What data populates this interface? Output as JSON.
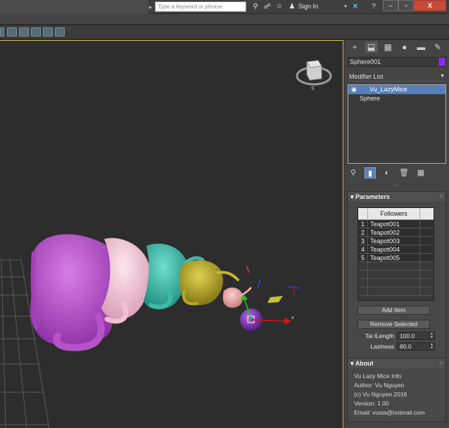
{
  "titlebar": {
    "search_placeholder": "Type a keyword or phrase",
    "signin_label": "Sign In",
    "help_label": "?",
    "window_close": "X"
  },
  "command_panel": {
    "tabs": [
      "create-icon",
      "modify-icon",
      "hierarchy-icon",
      "motion-icon",
      "display-icon",
      "utilities-icon"
    ],
    "object_name": "Sphere001",
    "object_color": "#8a2be2",
    "modifier_list_label": "Modifier List",
    "stack": [
      {
        "label": "Vu_LazyMice",
        "selected": true
      },
      {
        "label": "Sphere",
        "selected": false
      }
    ]
  },
  "parameters": {
    "title": "Parameters",
    "followers_header": "Followers",
    "followers": [
      {
        "index": "1",
        "name": "Teapot001"
      },
      {
        "index": "2",
        "name": "Teapot002"
      },
      {
        "index": "3",
        "name": "Teapot003"
      },
      {
        "index": "4",
        "name": "Teapot004"
      },
      {
        "index": "5",
        "name": "Teapot005"
      }
    ],
    "add_item_label": "Add Item",
    "remove_selected_label": "Remove Selected",
    "tail_length_label": "Tai lLength",
    "tail_length_value": "100.0",
    "laziness_label": "Laziness",
    "laziness_value": "80.0"
  },
  "about": {
    "title": "About",
    "lines": [
      "Vu Lazy Mice Info",
      "Author: Vu Nguyen",
      "(c) Vu Nguyen 2016",
      "Version: 1.00",
      "Email: vusta@hotmail.com"
    ]
  },
  "viewcube": {
    "south_label": "S"
  },
  "gizmo": {
    "x_label": "x"
  },
  "colors": {
    "teapot_purple": "#b34fc6",
    "teapot_pink": "#f4c8d8",
    "teapot_teal": "#3fb8a8",
    "teapot_olive": "#b8a82a",
    "teapot_salmon": "#f0a8a8",
    "sphere_purple": "#7a2fb8",
    "viewport_border": "#d6c15a",
    "selection_blue": "#557fb8"
  }
}
